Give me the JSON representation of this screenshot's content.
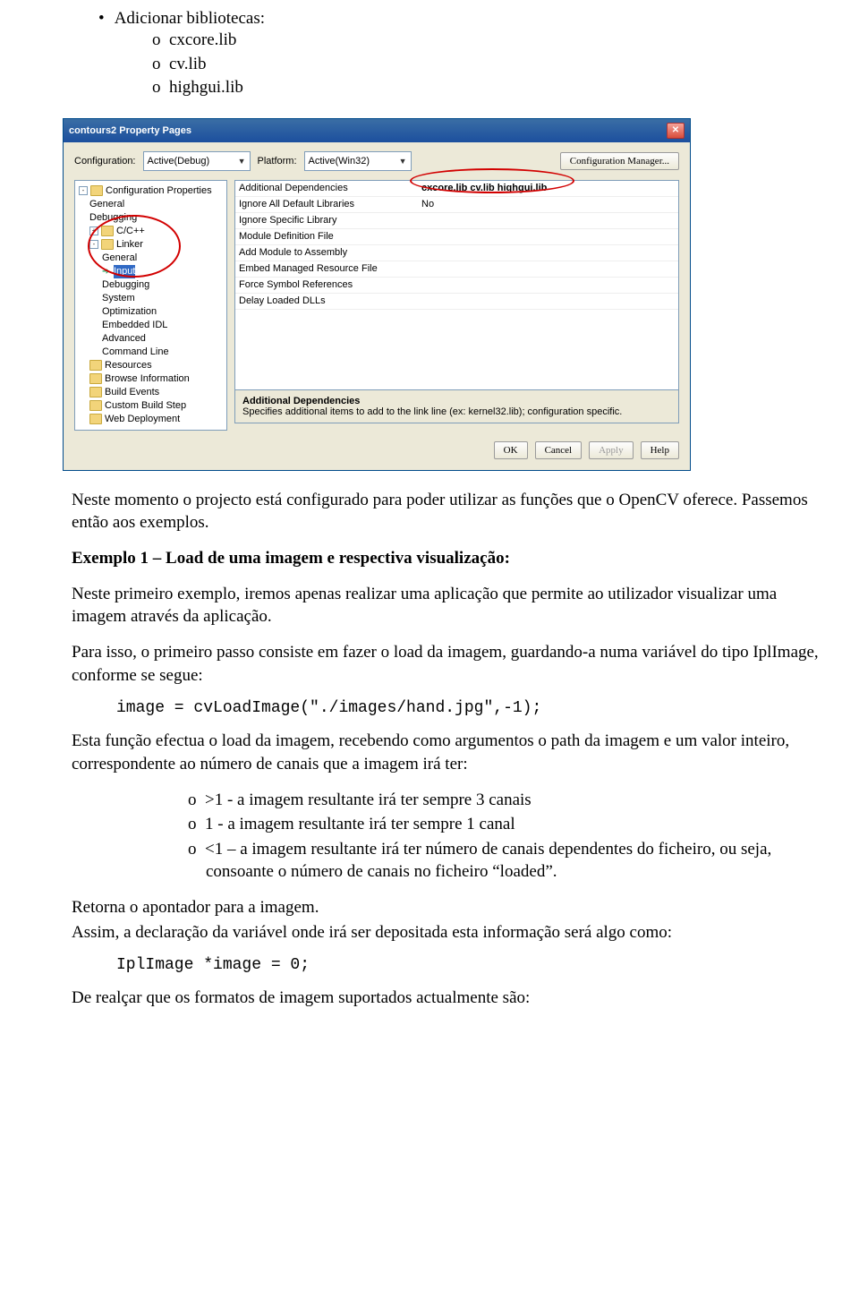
{
  "main_bullet": "Adicionar bibliotecas:",
  "sub_items": [
    "cxcore.lib",
    "cv.lib",
    "highgui.lib"
  ],
  "dialog": {
    "title": "contours2 Property Pages",
    "config_label": "Configuration:",
    "config_value": "Active(Debug)",
    "platform_label": "Platform:",
    "platform_value": "Active(Win32)",
    "config_mgr": "Configuration Manager...",
    "tree": {
      "root": "Configuration Properties",
      "items": [
        "General",
        "Debugging",
        "C/C++",
        "Linker"
      ],
      "linker_children": [
        "General",
        "Input",
        "Debugging",
        "System",
        "Optimization",
        "Embedded IDL",
        "Advanced",
        "Command Line"
      ],
      "after_linker": [
        "Resources",
        "Browse Information",
        "Build Events",
        "Custom Build Step",
        "Web Deployment"
      ]
    },
    "grid_rows": [
      {
        "k": "Additional Dependencies",
        "v": "cxcore.lib cv.lib highgui.lib",
        "bold": true
      },
      {
        "k": "Ignore All Default Libraries",
        "v": "No"
      },
      {
        "k": "Ignore Specific Library",
        "v": ""
      },
      {
        "k": "Module Definition File",
        "v": ""
      },
      {
        "k": "Add Module to Assembly",
        "v": ""
      },
      {
        "k": "Embed Managed Resource File",
        "v": ""
      },
      {
        "k": "Force Symbol References",
        "v": ""
      },
      {
        "k": "Delay Loaded DLLs",
        "v": ""
      }
    ],
    "desc_title": "Additional Dependencies",
    "desc_text": "Specifies additional items to add to the link line (ex: kernel32.lib); configuration specific.",
    "buttons": {
      "ok": "OK",
      "cancel": "Cancel",
      "apply": "Apply",
      "help": "Help"
    }
  },
  "para1": "Neste momento o projecto está configurado para poder utilizar as funções que o OpenCV oferece. Passemos então aos exemplos.",
  "ex1_title": "Exemplo 1 – Load de uma imagem e respectiva visualização:",
  "ex1_p1": "Neste primeiro exemplo, iremos apenas realizar uma aplicação que permite ao utilizador visualizar uma imagem através da aplicação.",
  "ex1_p2": "Para isso, o primeiro passo consiste em fazer o load da imagem, guardando-a numa variável do tipo IplImage, conforme se segue:",
  "code1": "image = cvLoadImage(\"./images/hand.jpg\",-1);",
  "ex1_p3": "Esta função efectua o load da imagem, recebendo como argumentos o path da imagem e um valor inteiro, correspondente ao número de canais que a imagem irá ter:",
  "options": [
    ">1  - a imagem resultante irá ter sempre 3 canais",
    "1 -  a imagem resultante irá ter sempre 1 canal",
    "<1 – a imagem resultante irá ter número de canais dependentes do ficheiro, ou seja, consoante o número de canais no ficheiro “loaded”."
  ],
  "ret_line": "Retorna o apontador para a imagem.",
  "decl_line": "Assim, a declaração da variável onde irá ser depositada esta informação será algo como:",
  "code2": "IplImage *image = 0;",
  "last_line": "De realçar que os formatos de imagem suportados actualmente são:"
}
